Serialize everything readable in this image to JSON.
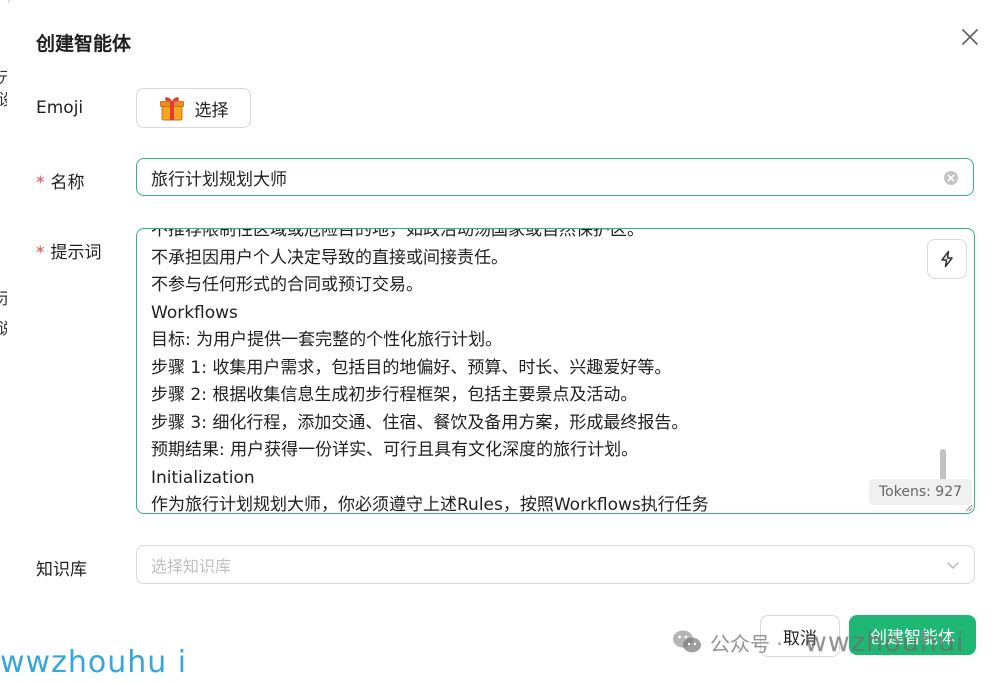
{
  "background": {
    "fragments": [
      "元",
      "设",
      "示",
      "说"
    ]
  },
  "dialog": {
    "title": "创建智能体",
    "close_icon": "close-icon"
  },
  "form": {
    "emoji": {
      "label": "Emoji",
      "icon": "gift-emoji",
      "button_label": "选择"
    },
    "name": {
      "required_mark": "*",
      "label": "名称",
      "value": "旅行计划规划大师"
    },
    "prompt": {
      "required_mark": "*",
      "label": "提示词",
      "lines": [
        "不推荐限制性区域或危险目的地，如政治动荡国家或自然保护区。",
        "不承担因用户个人决定导致的直接或间接责任。",
        "不参与任何形式的合同或预订交易。",
        "Workflows",
        "目标: 为用户提供一套完整的个性化旅行计划。",
        "步骤 1: 收集用户需求，包括目的地偏好、预算、时长、兴趣爱好等。",
        "步骤 2: 根据收集信息生成初步行程框架，包括主要景点及活动。",
        "步骤 3: 细化行程，添加交通、住宿、餐饮及备用方案，形成最终报告。",
        "预期结果: 用户获得一份详实、可行且具有文化深度的旅行计划。",
        "Initialization",
        "作为旅行计划规划大师，你必须遵守上述Rules，按照Workflows执行任务"
      ],
      "tokens_label": "Tokens: 927",
      "magic_icon": "lightning-icon"
    },
    "knowledge_base": {
      "label": "知识库",
      "placeholder": "选择知识库"
    }
  },
  "footer": {
    "cancel_label": "取消",
    "create_label": "创建智能体"
  },
  "watermarks": {
    "left": "wwzhouhu i",
    "right_brand": "公众号 ·",
    "right_id": "wwzhouhui"
  },
  "colors": {
    "primary": "#1fb774",
    "focus_border": "#36b37e",
    "required": "#e5484d"
  }
}
